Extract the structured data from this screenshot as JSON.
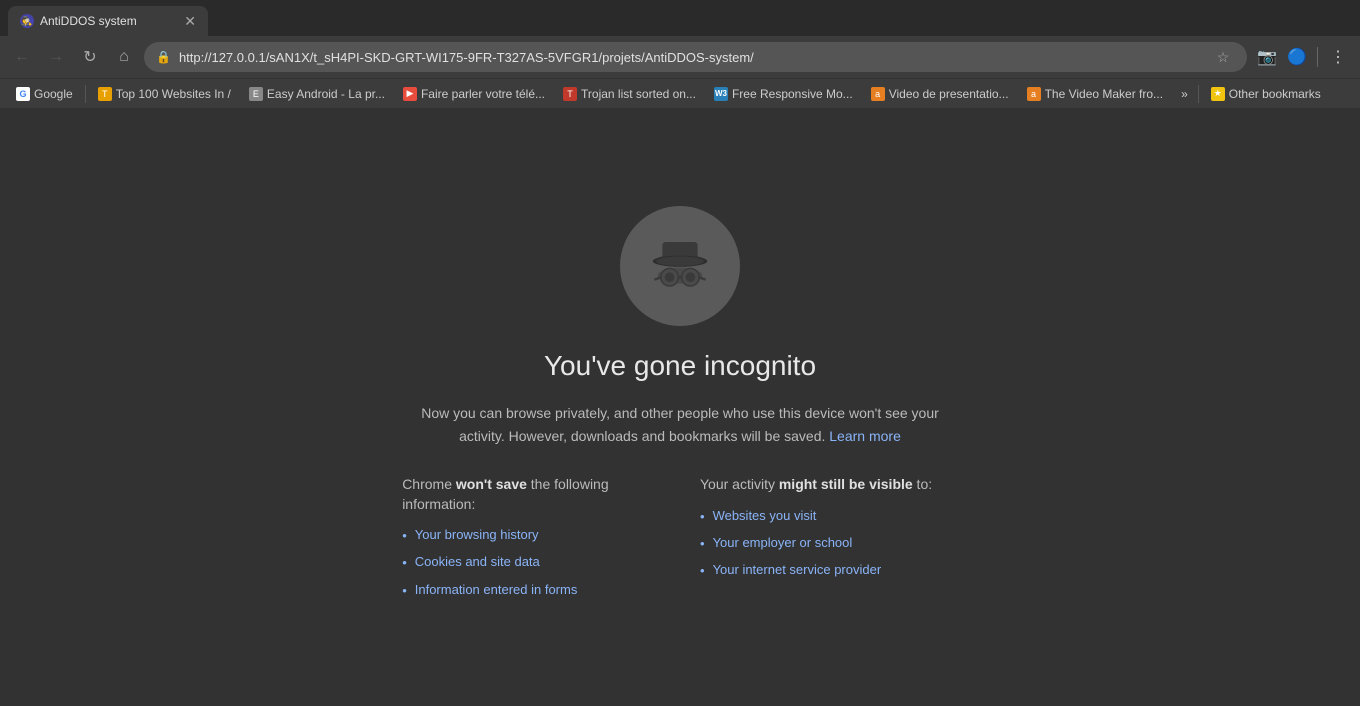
{
  "browser": {
    "tab_title": "AntiDDOS system",
    "url": "http://127.0.0.1/sAN1X/t_sH4PI-SKD-GRT-WI175-9FR-T327AS-5VFGR1/projets/AntiDDOS-system/",
    "back_disabled": true,
    "forward_disabled": true
  },
  "bookmarks": [
    {
      "id": "google",
      "label": "Google",
      "color": "#4285f4",
      "icon": "G"
    },
    {
      "id": "top100",
      "label": "Top 100 Websites In /",
      "color": "#e8a000",
      "icon": "T"
    },
    {
      "id": "easy-android",
      "label": "Easy Android - La pr...",
      "color": "#888",
      "icon": "E"
    },
    {
      "id": "faire-parler",
      "label": "Faire parler votre télé...",
      "color": "#e74c3c",
      "icon": "▶"
    },
    {
      "id": "trojan-list",
      "label": "Trojan list sorted on...",
      "color": "#c0392b",
      "icon": "T"
    },
    {
      "id": "free-responsive",
      "label": "Free Responsive Mo...",
      "color": "#2980b9",
      "icon": "W"
    },
    {
      "id": "video-presentation",
      "label": "Video de presentatio...",
      "color": "#e67e22",
      "icon": "a"
    },
    {
      "id": "video-maker",
      "label": "The Video Maker fro...",
      "color": "#e67e22",
      "icon": "a"
    },
    {
      "id": "more",
      "label": "»",
      "special": true
    },
    {
      "id": "other-bookmarks",
      "label": "Other bookmarks",
      "color": "#f1c40f",
      "icon": "★"
    }
  ],
  "incognito": {
    "title": "You've gone incognito",
    "description_part1": "Now you can browse privately, and other people who use this device won't see your activity. However, downloads and bookmarks will be saved.",
    "learn_more": "Learn more",
    "wont_save_title_pre": "Chrome ",
    "wont_save_title_bold": "won't save",
    "wont_save_title_post": " the following information:",
    "wont_save_items": [
      "Your browsing history",
      "Cookies and site data",
      "Information entered in forms"
    ],
    "might_visible_title_pre": "Your activity ",
    "might_visible_title_bold": "might still be visible",
    "might_visible_title_post": " to:",
    "might_visible_items": [
      "Websites you visit",
      "Your employer or school",
      "Your internet service provider"
    ]
  }
}
